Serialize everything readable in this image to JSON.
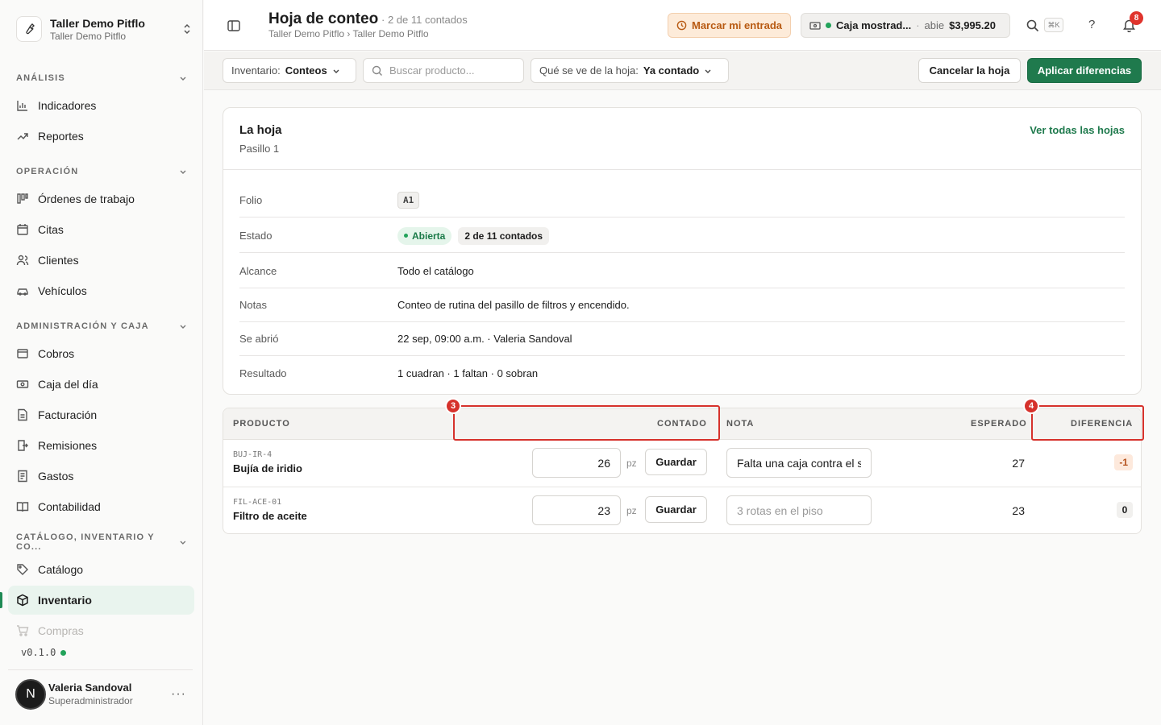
{
  "workspace": {
    "name": "Taller Demo Pitflo",
    "sub": "Taller Demo Pitflo"
  },
  "sidebar": {
    "sections": [
      {
        "label": "ANÁLISIS"
      },
      {
        "label": "OPERACIÓN"
      },
      {
        "label": "ADMINISTRACIÓN Y CAJA"
      },
      {
        "label": "CATÁLOGO, INVENTARIO Y CO..."
      }
    ],
    "items": [
      {
        "label": "Indicadores",
        "icon": "chart-bar-icon"
      },
      {
        "label": "Reportes",
        "icon": "trend-icon"
      },
      {
        "label": "Órdenes de trabajo",
        "icon": "kanban-icon"
      },
      {
        "label": "Citas",
        "icon": "calendar-icon"
      },
      {
        "label": "Clientes",
        "icon": "users-icon"
      },
      {
        "label": "Vehículos",
        "icon": "car-icon"
      },
      {
        "label": "Cobros",
        "icon": "wallet-icon"
      },
      {
        "label": "Caja del día",
        "icon": "cash-icon"
      },
      {
        "label": "Facturación",
        "icon": "invoice-icon"
      },
      {
        "label": "Remisiones",
        "icon": "delivery-icon"
      },
      {
        "label": "Gastos",
        "icon": "receipt-icon"
      },
      {
        "label": "Contabilidad",
        "icon": "book-icon"
      },
      {
        "label": "Catálogo",
        "icon": "tag-icon"
      },
      {
        "label": "Inventario",
        "icon": "box-icon"
      },
      {
        "label": "Compras",
        "icon": "cart-icon"
      }
    ],
    "version": "v0.1.0",
    "user": {
      "initial": "N",
      "name": "Valeria Sandoval",
      "role": "Superadministrador"
    }
  },
  "header": {
    "title": "Hoja de conteo",
    "count": "· 2 de 11 contados",
    "breadcrumb": "Taller Demo Pitflo › Taller Demo Pitflo",
    "entrada_label": "Marcar mi entrada",
    "caja": {
      "name": "Caja mostrad...",
      "sep": "·",
      "state": "abie",
      "amount": "$3,995.20"
    },
    "kbd": "⌘K",
    "help": "?",
    "notifications": "8"
  },
  "toolbar": {
    "inventory_label": "Inventario:",
    "inventory_value": "Conteos",
    "search_placeholder": "Buscar producto...",
    "view_label": "Qué se ve de la hoja:",
    "view_value": "Ya contado",
    "cancel_label": "Cancelar la hoja",
    "apply_label": "Aplicar diferencias"
  },
  "sheet": {
    "title": "La hoja",
    "subtitle": "Pasillo 1",
    "link": "Ver todas las hojas",
    "fields": {
      "folio_label": "Folio",
      "folio": "A1",
      "estado_label": "Estado",
      "estado_pill": "Abierta",
      "estado_count": "2 de 11 contados",
      "alcance_label": "Alcance",
      "alcance": "Todo el catálogo",
      "notas_label": "Notas",
      "notas": "Conteo de rutina del pasillo de filtros y encendido.",
      "abrio_label": "Se abrió",
      "abrio": "22 sep, 09:00 a.m. · Valeria Sandoval",
      "resultado_label": "Resultado",
      "resultado": "1 cuadran · 1 faltan · 0 sobran"
    }
  },
  "table": {
    "columns": {
      "producto": "PRODUCTO",
      "contado": "CONTADO",
      "nota": "NOTA",
      "esperado": "ESPERADO",
      "diferencia": "DIFERENCIA"
    },
    "unit": "pz",
    "save_label": "Guardar",
    "rows": [
      {
        "sku": "BUJ-IR-4",
        "name": "Bujía de iridio",
        "counted": "26",
        "note": "Falta una caja contra el sistema",
        "note_placeholder": "",
        "expected": "27",
        "diff": "-1"
      },
      {
        "sku": "FIL-ACE-01",
        "name": "Filtro de aceite",
        "counted": "23",
        "note": "",
        "note_placeholder": "3 rotas en el piso",
        "expected": "23",
        "diff": "0"
      }
    ]
  },
  "annotations": {
    "contado": "3",
    "diferencia": "4"
  },
  "colors": {
    "accent": "#1f7a4d",
    "danger": "#d6322c",
    "warning_bg": "#fdebd9"
  }
}
